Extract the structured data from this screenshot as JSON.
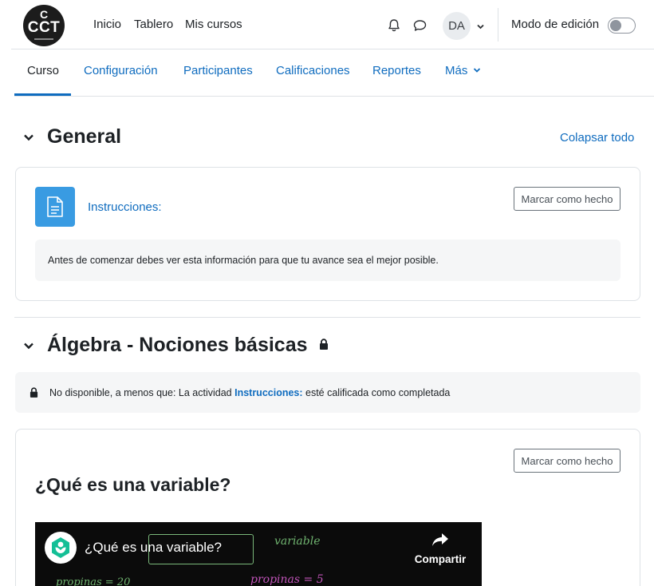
{
  "logo": {
    "text": "CCT",
    "c_mark": "C"
  },
  "topnav": {
    "items": [
      "Inicio",
      "Tablero",
      "Mis cursos"
    ]
  },
  "icons": {
    "notifications": "bell-icon",
    "messages": "chat-bubble-icon",
    "user_menu": "chevron-down-icon"
  },
  "user": {
    "initials": "DA"
  },
  "edit_mode": {
    "label": "Modo de edición",
    "enabled": false
  },
  "tabs": [
    "Curso",
    "Configuración",
    "Participantes",
    "Calificaciones",
    "Reportes",
    "Más"
  ],
  "active_tab": "Curso",
  "colors": {
    "accent": "#0f6cbf",
    "resource_icon": "#399be2",
    "text": "#1d2125"
  },
  "sections": [
    {
      "title": "General",
      "collapse_all": "Colapsar todo",
      "activity": {
        "name": "Instrucciones:",
        "icon": "document-icon",
        "done_button": "Marcar como hecho",
        "description": "Antes de comenzar debes ver esta información para que tu avance sea el mejor posible."
      }
    },
    {
      "title": "Álgebra - Nociones básicas",
      "locked": true,
      "restriction": {
        "prefix": "No disponible, a menos que: La actividad ",
        "link": "Instrucciones:",
        "suffix": " esté calificada como completada"
      },
      "activity": {
        "title": "¿Qué es una variable?",
        "done_button": "Marcar como hecho",
        "video": {
          "title": "¿Qué es una variable?",
          "share_label": "Compartir",
          "board_words": [
            "variable",
            "propinas = 5",
            "propinas = 20"
          ]
        }
      }
    }
  ]
}
